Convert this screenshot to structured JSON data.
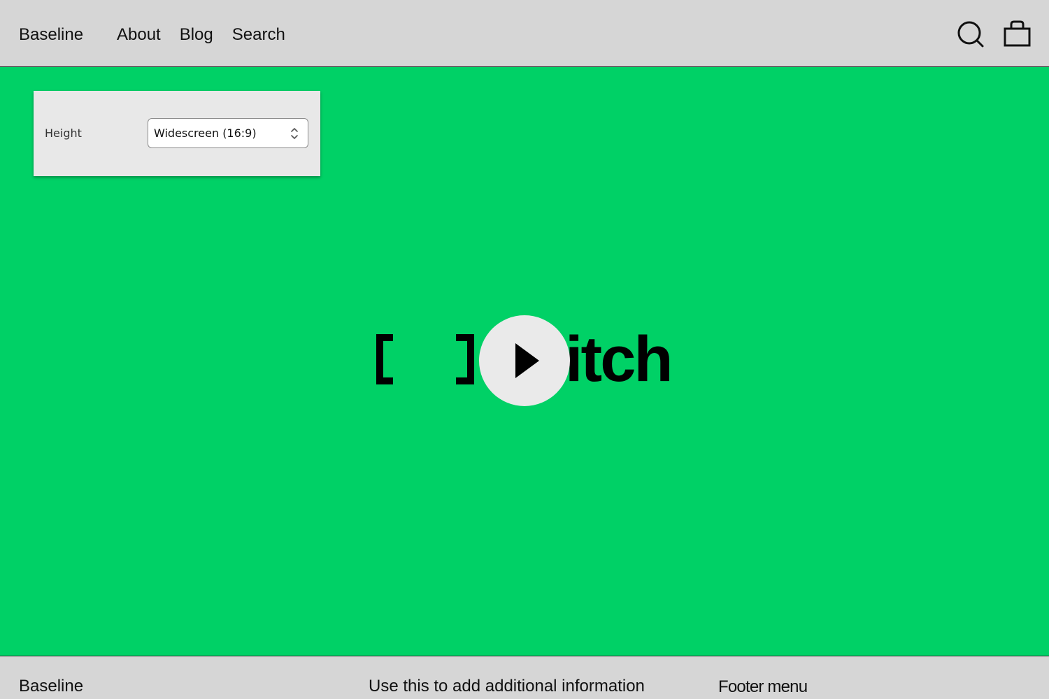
{
  "header": {
    "brand": "Baseline",
    "nav": [
      {
        "label": "About"
      },
      {
        "label": "Blog"
      },
      {
        "label": "Search"
      }
    ],
    "icons": [
      "search-icon",
      "shopping-bag-icon"
    ]
  },
  "hero": {
    "background_color": "#00d166",
    "logo_text": "itch",
    "logo_icon": "brackets-logo-icon",
    "play_icon": "play-icon"
  },
  "settings_panel": {
    "label": "Height",
    "select": {
      "value": "Widescreen (16:9)"
    }
  },
  "footer": {
    "brand": "Baseline",
    "info": "Use this to add additional information",
    "menu_title": "Footer menu"
  }
}
